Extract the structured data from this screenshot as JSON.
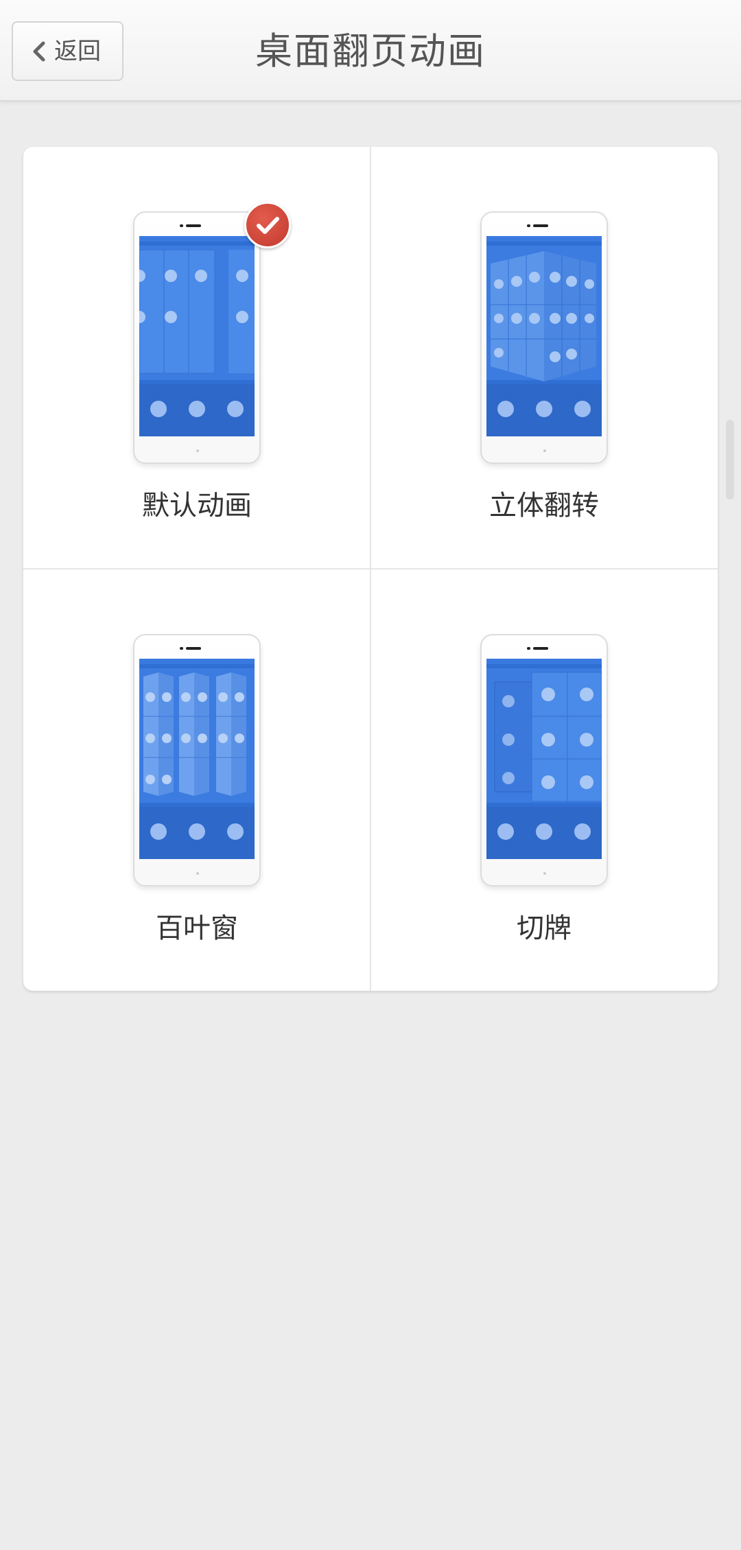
{
  "header": {
    "back_label": "返回",
    "title": "桌面翻页动画"
  },
  "options": [
    {
      "label": "默认动画",
      "selected": true,
      "preview_icon": "phone-default-animation-icon"
    },
    {
      "label": "立体翻转",
      "selected": false,
      "preview_icon": "phone-cube-flip-icon"
    },
    {
      "label": "百叶窗",
      "selected": false,
      "preview_icon": "phone-blinds-icon"
    },
    {
      "label": "切牌",
      "selected": false,
      "preview_icon": "phone-card-cut-icon"
    }
  ],
  "colors": {
    "accent_check": "#c9463a",
    "screen_blue": "#2f6ed3",
    "background": "#ececec"
  }
}
